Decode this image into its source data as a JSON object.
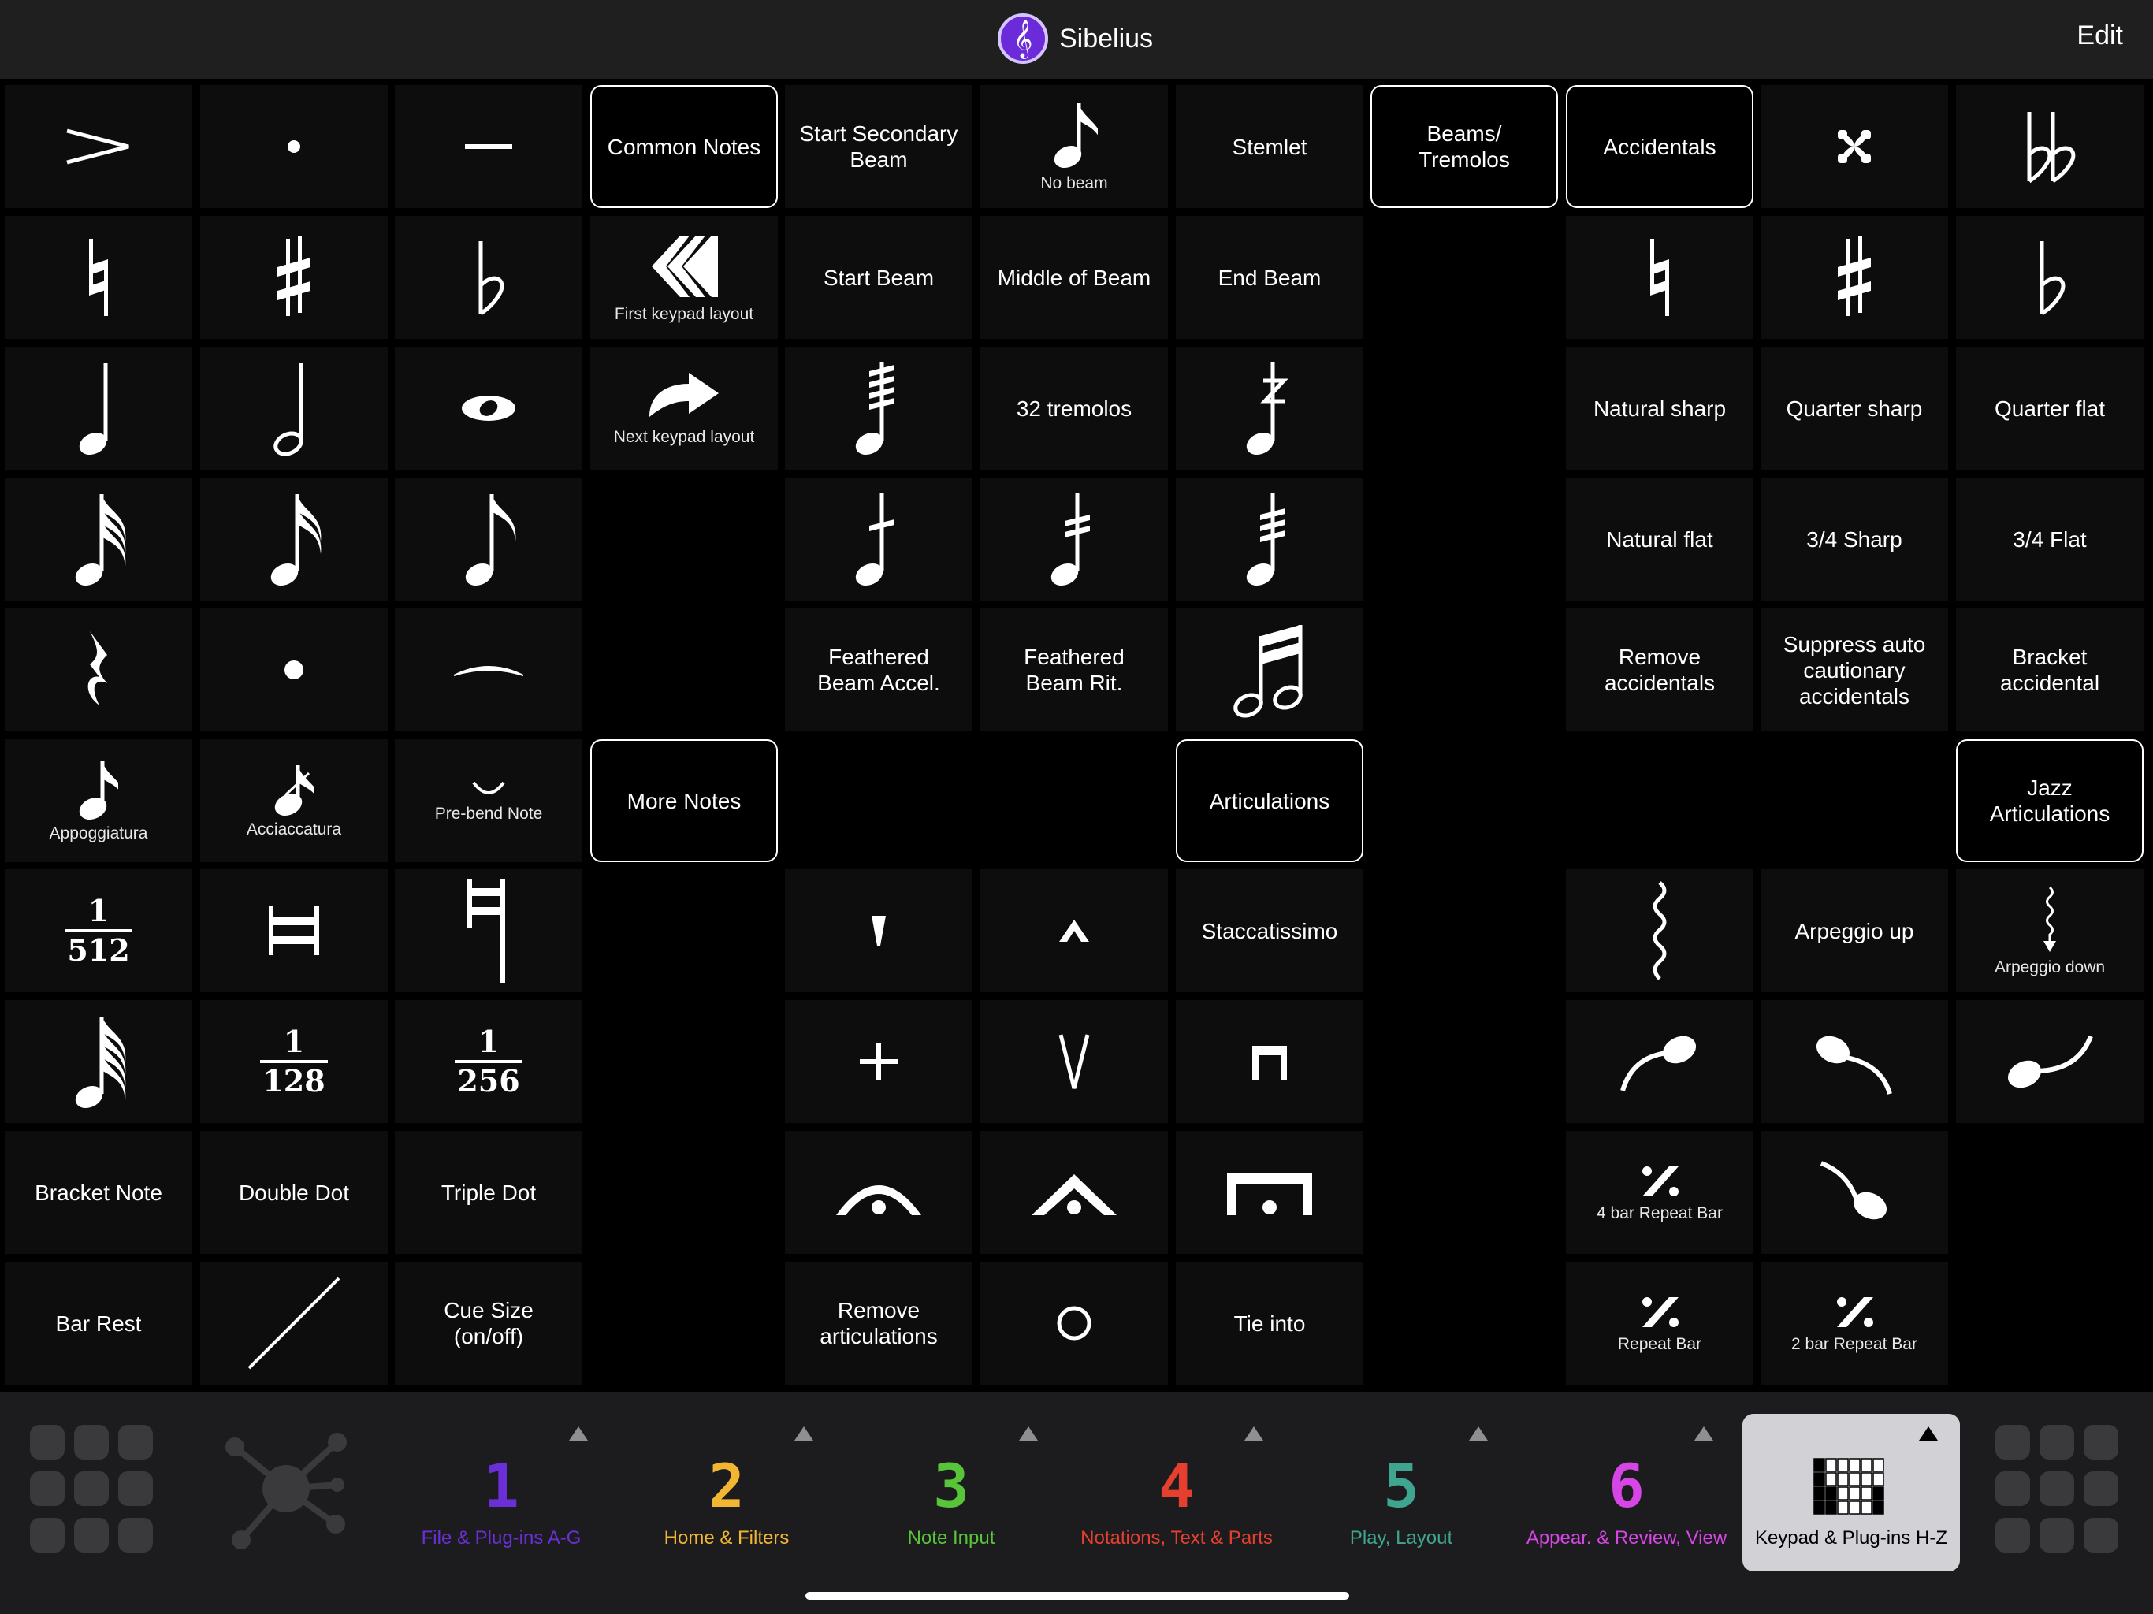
{
  "header": {
    "app_title": "Sibelius",
    "edit_label": "Edit",
    "logo_icon": "treble-clef-icon"
  },
  "grid": {
    "columns": 11,
    "rows": [
      [
        {
          "icon": "accent"
        },
        {
          "icon": "staccato"
        },
        {
          "icon": "tenuto"
        },
        {
          "label": "Common Notes",
          "group": true
        },
        {
          "label": "Start Secondary\nBeam"
        },
        {
          "icon": "eighth-note",
          "caption": "No beam"
        },
        {
          "label": "Stemlet"
        },
        {
          "label": "Beams/\nTremolos",
          "group": true
        },
        {
          "label": "Accidentals",
          "group": true
        },
        {
          "icon": "double-sharp"
        },
        {
          "icon": "double-flat"
        }
      ],
      [
        {
          "icon": "natural"
        },
        {
          "icon": "sharp"
        },
        {
          "icon": "flat"
        },
        {
          "icon": "chevrons-left",
          "caption": "First keypad layout"
        },
        {
          "label": "Start Beam"
        },
        {
          "label": "Middle of Beam"
        },
        {
          "label": "End Beam"
        },
        {
          "empty": true
        },
        {
          "icon": "natural"
        },
        {
          "icon": "sharp"
        },
        {
          "icon": "flat"
        }
      ],
      [
        {
          "icon": "quarter-note"
        },
        {
          "icon": "half-note"
        },
        {
          "icon": "whole-note"
        },
        {
          "icon": "curved-arrow",
          "caption": "Next keypad layout"
        },
        {
          "icon": "note-4-tremolo"
        },
        {
          "label": "32 tremolos"
        },
        {
          "icon": "note-z-tremolo"
        },
        {
          "empty": true
        },
        {
          "label": "Natural sharp"
        },
        {
          "label": "Quarter sharp"
        },
        {
          "label": "Quarter flat"
        }
      ],
      [
        {
          "icon": "32nd-note"
        },
        {
          "icon": "16th-note"
        },
        {
          "icon": "eighth-note-lg"
        },
        {
          "empty": true
        },
        {
          "icon": "note-1-tremolo"
        },
        {
          "icon": "note-2-tremolo"
        },
        {
          "icon": "note-3-tremolo"
        },
        {
          "empty": true
        },
        {
          "label": "Natural flat"
        },
        {
          "label": "3/4 Sharp"
        },
        {
          "label": "3/4 Flat"
        }
      ],
      [
        {
          "icon": "quarter-rest"
        },
        {
          "icon": "dot"
        },
        {
          "icon": "tie"
        },
        {
          "empty": true
        },
        {
          "label": "Feathered\nBeam Accel."
        },
        {
          "label": "Feathered\nBeam Rit."
        },
        {
          "icon": "beamed-half-notes"
        },
        {
          "empty": true
        },
        {
          "label": "Remove\naccidentals"
        },
        {
          "label": "Suppress auto\ncautionary\naccidentals"
        },
        {
          "label": "Bracket\naccidental"
        }
      ],
      [
        {
          "icon": "grace-note",
          "caption": "Appoggiatura"
        },
        {
          "icon": "acciaccatura",
          "caption": "Acciaccatura"
        },
        {
          "icon": "pre-bend",
          "caption": "Pre-bend Note"
        },
        {
          "label": "More Notes",
          "group": true
        },
        {
          "empty": true
        },
        {
          "empty": true
        },
        {
          "label": "Articulations",
          "group": true
        },
        {
          "empty": true
        },
        {
          "empty": true
        },
        {
          "empty": true
        },
        {
          "label": "Jazz\nArticulations",
          "group": true
        }
      ],
      [
        {
          "icon": "fraction",
          "num": "1",
          "den": "512"
        },
        {
          "icon": "breve"
        },
        {
          "icon": "longa"
        },
        {
          "empty": true
        },
        {
          "icon": "staccatissimo"
        },
        {
          "icon": "marcato"
        },
        {
          "label": "Staccatissimo"
        },
        {
          "empty": true
        },
        {
          "icon": "arpeggio"
        },
        {
          "label": "Arpeggio up"
        },
        {
          "icon": "arpeggio-down",
          "caption": "Arpeggio down"
        }
      ],
      [
        {
          "icon": "64th-note"
        },
        {
          "icon": "fraction",
          "num": "1",
          "den": "128"
        },
        {
          "icon": "fraction",
          "num": "1",
          "den": "256"
        },
        {
          "empty": true
        },
        {
          "icon": "plus"
        },
        {
          "icon": "up-bow"
        },
        {
          "icon": "down-bow"
        },
        {
          "empty": true
        },
        {
          "icon": "scoop"
        },
        {
          "icon": "fall"
        },
        {
          "icon": "doit"
        }
      ],
      [
        {
          "label": "Bracket Note"
        },
        {
          "label": "Double Dot"
        },
        {
          "label": "Triple Dot"
        },
        {
          "empty": true
        },
        {
          "icon": "fermata"
        },
        {
          "icon": "fermata-triangle"
        },
        {
          "icon": "fermata-square"
        },
        {
          "empty": true
        },
        {
          "icon": "repeat-bar",
          "caption": "4 bar Repeat Bar"
        },
        {
          "icon": "plop"
        },
        {
          "empty": true
        }
      ],
      [
        {
          "label": "Bar Rest"
        },
        {
          "icon": "slash"
        },
        {
          "label": "Cue Size\n(on/off)"
        },
        {
          "empty": true
        },
        {
          "label": "Remove\narticulations"
        },
        {
          "icon": "circle"
        },
        {
          "label": "Tie into"
        },
        {
          "empty": true
        },
        {
          "icon": "repeat-bar",
          "caption": "Repeat Bar"
        },
        {
          "icon": "repeat-bar",
          "caption": "2 bar Repeat Bar"
        },
        {
          "empty": true
        }
      ]
    ]
  },
  "toolbar": {
    "left_icon": "keypad-grid-icon",
    "network_icon": "network-icon",
    "right_icon": "keypad-grid-icon",
    "tabs": [
      {
        "number": "1",
        "label": "File & Plug-ins A-G",
        "color": "#6a2fd6"
      },
      {
        "number": "2",
        "label": "Home & Filters",
        "color": "#f2b632"
      },
      {
        "number": "3",
        "label": "Note Input",
        "color": "#58c43a"
      },
      {
        "number": "4",
        "label": "Notations, Text & Parts",
        "color": "#e5402f"
      },
      {
        "number": "5",
        "label": "Play, Layout",
        "color": "#3fa58f"
      },
      {
        "number": "6",
        "label": "Appear. & Review, View",
        "color": "#d646e6"
      },
      {
        "number": "",
        "label": "Keypad & Plug-ins H-Z",
        "color": "#000000",
        "active": true,
        "icon": "keypad-pattern-icon"
      }
    ]
  }
}
